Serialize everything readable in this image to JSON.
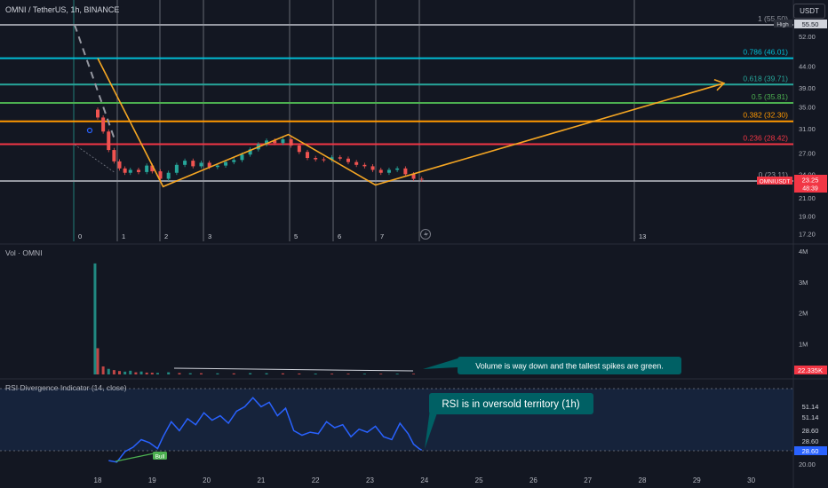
{
  "header": {
    "symbol_title": "OMNI / TetherUS, 1h, BINANCE",
    "currency_button": "USDT"
  },
  "volume_pane": {
    "title": "Vol · OMNI",
    "last_value": "22.335K"
  },
  "rsi_pane": {
    "title": "RSI Divergence Indicator (14, close)",
    "bull_label": "Bull"
  },
  "annotations": {
    "volume_note": "Volume is way down and the tallest spikes are green.",
    "rsi_note": "RSI is in oversold territory (1h)"
  },
  "colors": {
    "background": "#131722",
    "up_candle": "#26a69a",
    "down_candle": "#ef5350",
    "zigzag": "#f5a623",
    "rsi_line": "#2962ff",
    "callout": "#006064"
  },
  "chart_data": [
    {
      "type": "candlestick",
      "title": "OMNI / TetherUS, 1h, BINANCE",
      "ylim": [
        17.2,
        56.5
      ],
      "y_scale": "log",
      "y_ticks": [
        "52.00",
        "44.00",
        "39.00",
        "35.00",
        "31.00",
        "27.00",
        "24.00",
        "21.00",
        "19.00",
        "17.20"
      ],
      "high_label": {
        "value": "55.50",
        "tag": "High"
      },
      "last_price": {
        "symbol": "OMNIUSDT",
        "price": "23.25",
        "countdown": "48:39"
      },
      "fib_levels": [
        {
          "label": "1 (55.50)",
          "value": 55.5,
          "color": "#9598a1"
        },
        {
          "label": "0.786 (46.01)",
          "value": 46.01,
          "color": "#00bcd4"
        },
        {
          "label": "0.618 (39.71)",
          "value": 39.71,
          "color": "#26a69a"
        },
        {
          "label": "0.5 (35.81)",
          "value": 35.81,
          "color": "#4caf50"
        },
        {
          "label": "0.382 (32.30)",
          "value": 32.3,
          "color": "#ff9800"
        },
        {
          "label": "0.236 (28.42)",
          "value": 28.42,
          "color": "#f23645"
        },
        {
          "label": "0 (23.11)",
          "value": 23.11,
          "color": "#9598a1"
        }
      ],
      "vertical_markers": [
        "0",
        "1",
        "2",
        "3",
        "5",
        "6",
        "7",
        "13"
      ],
      "zigzag_path": [
        {
          "date": 18.0,
          "price": 46.01
        },
        {
          "date": 19.2,
          "price": 22.4
        },
        {
          "date": 21.5,
          "price": 30.0
        },
        {
          "date": 23.1,
          "price": 22.6
        },
        {
          "date": 29.5,
          "price": 40.0
        }
      ],
      "close_series": [
        {
          "date": 18.0,
          "close": 33.0
        },
        {
          "date": 18.1,
          "close": 30.5
        },
        {
          "date": 18.2,
          "close": 27.5
        },
        {
          "date": 18.3,
          "close": 25.8
        },
        {
          "date": 18.4,
          "close": 24.8
        },
        {
          "date": 18.5,
          "close": 24.2
        },
        {
          "date": 18.6,
          "close": 24.6
        },
        {
          "date": 18.75,
          "close": 24.3
        },
        {
          "date": 18.9,
          "close": 25.2
        },
        {
          "date": 19.0,
          "close": 24.4
        },
        {
          "date": 19.15,
          "close": 23.4
        },
        {
          "date": 19.3,
          "close": 24.2
        },
        {
          "date": 19.45,
          "close": 25.3
        },
        {
          "date": 19.6,
          "close": 25.9
        },
        {
          "date": 19.75,
          "close": 25.1
        },
        {
          "date": 19.9,
          "close": 25.6
        },
        {
          "date": 20.05,
          "close": 25.0
        },
        {
          "date": 20.2,
          "close": 25.2
        },
        {
          "date": 20.35,
          "close": 25.7
        },
        {
          "date": 20.5,
          "close": 26.0
        },
        {
          "date": 20.65,
          "close": 26.8
        },
        {
          "date": 20.8,
          "close": 27.6
        },
        {
          "date": 20.95,
          "close": 28.4
        },
        {
          "date": 21.1,
          "close": 29.0
        },
        {
          "date": 21.25,
          "close": 28.6
        },
        {
          "date": 21.4,
          "close": 29.2
        },
        {
          "date": 21.55,
          "close": 28.2
        },
        {
          "date": 21.7,
          "close": 27.2
        },
        {
          "date": 21.85,
          "close": 26.3
        },
        {
          "date": 22.0,
          "close": 26.1
        },
        {
          "date": 22.15,
          "close": 26.0
        },
        {
          "date": 22.3,
          "close": 26.4
        },
        {
          "date": 22.45,
          "close": 26.2
        },
        {
          "date": 22.6,
          "close": 25.7
        },
        {
          "date": 22.75,
          "close": 25.3
        },
        {
          "date": 22.9,
          "close": 25.1
        },
        {
          "date": 23.05,
          "close": 24.6
        },
        {
          "date": 23.2,
          "close": 24.2
        },
        {
          "date": 23.35,
          "close": 24.6
        },
        {
          "date": 23.5,
          "close": 24.8
        },
        {
          "date": 23.65,
          "close": 24.0
        },
        {
          "date": 23.8,
          "close": 23.4
        },
        {
          "date": 23.95,
          "close": 23.3
        }
      ]
    },
    {
      "type": "bar",
      "title": "Vol · OMNI",
      "ylim": [
        0,
        4000000
      ],
      "y_ticks": [
        "4M",
        "3M",
        "2M",
        "1M"
      ],
      "last_value": "22.335K",
      "volume_series": [
        {
          "date": 17.95,
          "volume": 3600000,
          "dir": "up"
        },
        {
          "date": 18.0,
          "volume": 850000,
          "dir": "down"
        },
        {
          "date": 18.1,
          "volume": 260000,
          "dir": "down"
        },
        {
          "date": 18.2,
          "volume": 180000,
          "dir": "up"
        },
        {
          "date": 18.3,
          "volume": 140000,
          "dir": "down"
        },
        {
          "date": 18.4,
          "volume": 110000,
          "dir": "down"
        },
        {
          "date": 18.5,
          "volume": 90000,
          "dir": "up"
        },
        {
          "date": 18.6,
          "volume": 120000,
          "dir": "up"
        },
        {
          "date": 18.7,
          "volume": 70000,
          "dir": "down"
        },
        {
          "date": 18.8,
          "volume": 95000,
          "dir": "up"
        },
        {
          "date": 18.9,
          "volume": 60000,
          "dir": "down"
        },
        {
          "date": 19.0,
          "volume": 55000,
          "dir": "down"
        },
        {
          "date": 19.1,
          "volume": 50000,
          "dir": "up"
        },
        {
          "date": 19.3,
          "volume": 70000,
          "dir": "up"
        },
        {
          "date": 19.5,
          "volume": 45000,
          "dir": "down"
        },
        {
          "date": 19.7,
          "volume": 40000,
          "dir": "up"
        },
        {
          "date": 19.9,
          "volume": 38000,
          "dir": "down"
        },
        {
          "date": 20.2,
          "volume": 36000,
          "dir": "up"
        },
        {
          "date": 20.5,
          "volume": 34000,
          "dir": "down"
        },
        {
          "date": 20.8,
          "volume": 42000,
          "dir": "up"
        },
        {
          "date": 21.1,
          "volume": 40000,
          "dir": "up"
        },
        {
          "date": 21.4,
          "volume": 35000,
          "dir": "down"
        },
        {
          "date": 21.7,
          "volume": 30000,
          "dir": "down"
        },
        {
          "date": 22.0,
          "volume": 28000,
          "dir": "up"
        },
        {
          "date": 22.3,
          "volume": 26000,
          "dir": "down"
        },
        {
          "date": 22.6,
          "volume": 25000,
          "dir": "down"
        },
        {
          "date": 22.9,
          "volume": 24000,
          "dir": "up"
        },
        {
          "date": 23.2,
          "volume": 23000,
          "dir": "down"
        },
        {
          "date": 23.5,
          "volume": 24000,
          "dir": "up"
        },
        {
          "date": 23.8,
          "volume": 22335,
          "dir": "down"
        }
      ]
    },
    {
      "type": "line",
      "title": "RSI Divergence Indicator (14, close)",
      "ylim": [
        20,
        70
      ],
      "y_ticks": [
        "20.00"
      ],
      "value_labels": [
        "51.14",
        "51.14",
        "28.60",
        "28.60",
        "28.60"
      ],
      "bull_label": "Bull",
      "rsi_series": [
        {
          "date": 18.2,
          "rsi": 22
        },
        {
          "date": 18.35,
          "rsi": 21
        },
        {
          "date": 18.5,
          "rsi": 28
        },
        {
          "date": 18.65,
          "rsi": 31
        },
        {
          "date": 18.8,
          "rsi": 36
        },
        {
          "date": 18.95,
          "rsi": 34
        },
        {
          "date": 19.1,
          "rsi": 30
        },
        {
          "date": 19.2,
          "rsi": 38
        },
        {
          "date": 19.35,
          "rsi": 48
        },
        {
          "date": 19.5,
          "rsi": 42
        },
        {
          "date": 19.65,
          "rsi": 50
        },
        {
          "date": 19.8,
          "rsi": 46
        },
        {
          "date": 19.95,
          "rsi": 54
        },
        {
          "date": 20.1,
          "rsi": 49
        },
        {
          "date": 20.25,
          "rsi": 52
        },
        {
          "date": 20.4,
          "rsi": 47
        },
        {
          "date": 20.55,
          "rsi": 55
        },
        {
          "date": 20.7,
          "rsi": 58
        },
        {
          "date": 20.85,
          "rsi": 64
        },
        {
          "date": 21.0,
          "rsi": 58
        },
        {
          "date": 21.15,
          "rsi": 61
        },
        {
          "date": 21.3,
          "rsi": 52
        },
        {
          "date": 21.45,
          "rsi": 57
        },
        {
          "date": 21.6,
          "rsi": 42
        },
        {
          "date": 21.75,
          "rsi": 39
        },
        {
          "date": 21.9,
          "rsi": 41
        },
        {
          "date": 22.05,
          "rsi": 40
        },
        {
          "date": 22.2,
          "rsi": 48
        },
        {
          "date": 22.35,
          "rsi": 44
        },
        {
          "date": 22.5,
          "rsi": 46
        },
        {
          "date": 22.65,
          "rsi": 38
        },
        {
          "date": 22.8,
          "rsi": 43
        },
        {
          "date": 22.95,
          "rsi": 41
        },
        {
          "date": 23.1,
          "rsi": 45
        },
        {
          "date": 23.25,
          "rsi": 38
        },
        {
          "date": 23.4,
          "rsi": 36
        },
        {
          "date": 23.55,
          "rsi": 47
        },
        {
          "date": 23.7,
          "rsi": 40
        },
        {
          "date": 23.8,
          "rsi": 33
        },
        {
          "date": 23.9,
          "rsi": 30
        },
        {
          "date": 23.95,
          "rsi": 29
        }
      ]
    }
  ],
  "x_axis": {
    "ticks": [
      "18",
      "19",
      "20",
      "21",
      "22",
      "23",
      "24",
      "25",
      "26",
      "27",
      "28",
      "29",
      "30"
    ]
  }
}
